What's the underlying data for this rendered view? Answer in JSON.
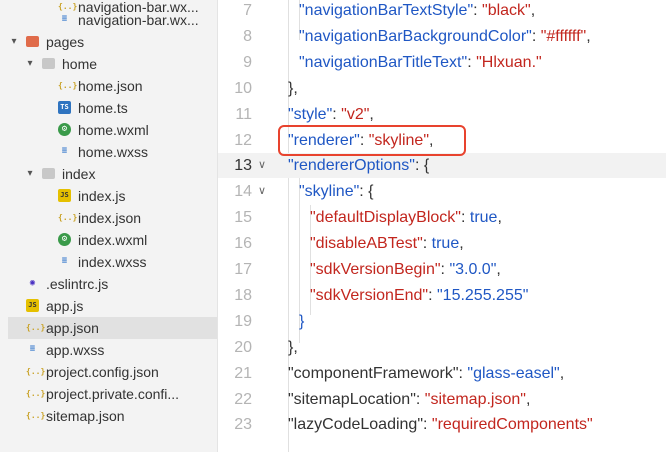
{
  "explorer": {
    "items": [
      {
        "label": "navigation-bar.wx...",
        "icon": "json-file-icon",
        "kind": "json"
      },
      {
        "label": "navigation-bar.wx...",
        "icon": "wxss-file-icon",
        "kind": "wxss"
      },
      {
        "label": "pages",
        "icon": "folder-icon",
        "kind": "folder-pkg",
        "expanded": true
      },
      {
        "label": "home",
        "icon": "folder-icon",
        "kind": "folder",
        "expanded": true
      },
      {
        "label": "home.json",
        "icon": "json-file-icon",
        "kind": "json"
      },
      {
        "label": "home.ts",
        "icon": "ts-file-icon",
        "kind": "ts"
      },
      {
        "label": "home.wxml",
        "icon": "wxml-file-icon",
        "kind": "wxml"
      },
      {
        "label": "home.wxss",
        "icon": "wxss-file-icon",
        "kind": "wxss"
      },
      {
        "label": "index",
        "icon": "folder-icon",
        "kind": "folder",
        "expanded": true
      },
      {
        "label": "index.js",
        "icon": "js-file-icon",
        "kind": "js"
      },
      {
        "label": "index.json",
        "icon": "json-file-icon",
        "kind": "json"
      },
      {
        "label": "index.wxml",
        "icon": "wxml-file-icon",
        "kind": "wxml"
      },
      {
        "label": "index.wxss",
        "icon": "wxss-file-icon",
        "kind": "wxss"
      },
      {
        "label": ".eslintrc.js",
        "icon": "eslint-file-icon",
        "kind": "eslint"
      },
      {
        "label": "app.js",
        "icon": "js-file-icon",
        "kind": "js"
      },
      {
        "label": "app.json",
        "icon": "json-file-icon",
        "kind": "json",
        "selected": true
      },
      {
        "label": "app.wxss",
        "icon": "wxss-file-icon",
        "kind": "wxss"
      },
      {
        "label": "project.config.json",
        "icon": "json-file-icon",
        "kind": "json"
      },
      {
        "label": "project.private.confi...",
        "icon": "json-file-icon",
        "kind": "json"
      },
      {
        "label": "sitemap.json",
        "icon": "json-file-icon",
        "kind": "json"
      }
    ]
  },
  "editor": {
    "current_line": 13,
    "lines": [
      {
        "num": "7",
        "indent": 2,
        "tokens": [
          {
            "t": "k",
            "v": "\"navigationBarTextStyle\""
          },
          {
            "t": "p",
            "v": ": "
          },
          {
            "t": "s",
            "v": "\"black\""
          },
          {
            "t": "p",
            "v": ","
          }
        ]
      },
      {
        "num": "8",
        "indent": 2,
        "tokens": [
          {
            "t": "k",
            "v": "\"navigationBarBackgroundColor\""
          },
          {
            "t": "p",
            "v": ": "
          },
          {
            "t": "s",
            "v": "\"#ffffff\""
          },
          {
            "t": "p",
            "v": ","
          }
        ]
      },
      {
        "num": "9",
        "indent": 2,
        "tokens": [
          {
            "t": "k",
            "v": "\"navigationBarTitleText\""
          },
          {
            "t": "p",
            "v": ": "
          },
          {
            "t": "s",
            "v": "\"Hlxuan.\""
          }
        ]
      },
      {
        "num": "10",
        "indent": 1,
        "tokens": [
          {
            "t": "p",
            "v": "},"
          }
        ]
      },
      {
        "num": "11",
        "indent": 1,
        "tokens": [
          {
            "t": "k",
            "v": "\"style\""
          },
          {
            "t": "p",
            "v": ": "
          },
          {
            "t": "s",
            "v": "\"v2\""
          },
          {
            "t": "p",
            "v": ","
          }
        ]
      },
      {
        "num": "12",
        "indent": 1,
        "tokens": [
          {
            "t": "k",
            "v": "\"renderer\""
          },
          {
            "t": "p",
            "v": ": "
          },
          {
            "t": "s",
            "v": "\"skyline\""
          },
          {
            "t": "p",
            "v": ","
          }
        ]
      },
      {
        "num": "13",
        "indent": 1,
        "fold": true,
        "tokens": [
          {
            "t": "k",
            "v": "\"rendererOptions\""
          },
          {
            "t": "p",
            "v": ": {"
          }
        ]
      },
      {
        "num": "14",
        "indent": 2,
        "fold": true,
        "tokens": [
          {
            "t": "k",
            "v": "\"skyline\""
          },
          {
            "t": "p",
            "v": ": {"
          }
        ]
      },
      {
        "num": "15",
        "indent": 3,
        "tokens": [
          {
            "t": "s",
            "v": "\"defaultDisplayBlock\""
          },
          {
            "t": "p",
            "v": ": "
          },
          {
            "t": "k",
            "v": "true"
          },
          {
            "t": "p",
            "v": ","
          }
        ]
      },
      {
        "num": "16",
        "indent": 3,
        "tokens": [
          {
            "t": "s",
            "v": "\"disableABTest\""
          },
          {
            "t": "p",
            "v": ": "
          },
          {
            "t": "k",
            "v": "true"
          },
          {
            "t": "p",
            "v": ","
          }
        ]
      },
      {
        "num": "17",
        "indent": 3,
        "tokens": [
          {
            "t": "s",
            "v": "\"sdkVersionBegin\""
          },
          {
            "t": "p",
            "v": ": "
          },
          {
            "t": "k",
            "v": "\"3.0.0\""
          },
          {
            "t": "p",
            "v": ","
          }
        ]
      },
      {
        "num": "18",
        "indent": 3,
        "tokens": [
          {
            "t": "s",
            "v": "\"sdkVersionEnd\""
          },
          {
            "t": "p",
            "v": ": "
          },
          {
            "t": "k",
            "v": "\"15.255.255\""
          }
        ]
      },
      {
        "num": "19",
        "indent": 2,
        "tokens": [
          {
            "t": "k",
            "v": "}"
          }
        ]
      },
      {
        "num": "20",
        "indent": 1,
        "tokens": [
          {
            "t": "p",
            "v": "},"
          }
        ]
      },
      {
        "num": "21",
        "indent": 1,
        "tokens": [
          {
            "t": "p",
            "v": "\"componentFramework\""
          },
          {
            "t": "p",
            "v": ": "
          },
          {
            "t": "k",
            "v": "\"glass-easel\""
          },
          {
            "t": "p",
            "v": ","
          }
        ]
      },
      {
        "num": "22",
        "indent": 1,
        "tokens": [
          {
            "t": "p",
            "v": "\"sitemapLocation\""
          },
          {
            "t": "p",
            "v": ": "
          },
          {
            "t": "s",
            "v": "\"sitemap.json\""
          },
          {
            "t": "p",
            "v": ","
          }
        ]
      },
      {
        "num": "23",
        "indent": 1,
        "tokens": [
          {
            "t": "p",
            "v": "\"lazyCodeLoading\""
          },
          {
            "t": "p",
            "v": ": "
          },
          {
            "t": "s",
            "v": "\"requiredComponents\""
          }
        ]
      }
    ]
  }
}
